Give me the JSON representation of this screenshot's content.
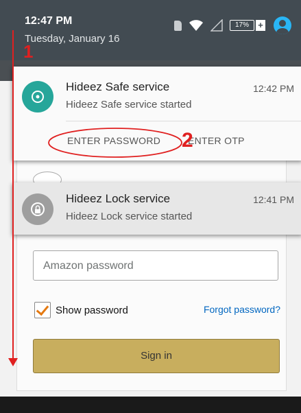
{
  "status_bar": {
    "time": "12:47 PM",
    "date": "Tuesday, January 16",
    "battery_level": "17%",
    "battery_charging_symbol": "+",
    "icons": [
      "sim-icon",
      "wifi-icon",
      "signal-icon",
      "battery-icon",
      "avatar-icon"
    ]
  },
  "notifications": [
    {
      "title": "Hideez Safe service",
      "text": "Hideez Safe service started",
      "time": "12:42 PM",
      "icon": "target-icon",
      "actions": [
        "ENTER PASSWORD",
        "ENTER OTP"
      ]
    },
    {
      "title": "Hideez Lock service",
      "text": "Hideez Lock service started",
      "time": "12:41 PM",
      "icon": "lock-icon"
    }
  ],
  "app": {
    "password_placeholder": "Amazon password",
    "show_password_label": "Show password",
    "show_password_checked": true,
    "forgot_password_link": "Forgot password?",
    "sign_in_button": "Sign in"
  },
  "annotations": {
    "marker_1": "1",
    "marker_2": "2"
  },
  "colors": {
    "status_bar": "#424b52",
    "safe_icon": "#26a69a",
    "annotation": "#e02020",
    "sign_in": "#c8ae5e",
    "link": "#0066c0"
  }
}
